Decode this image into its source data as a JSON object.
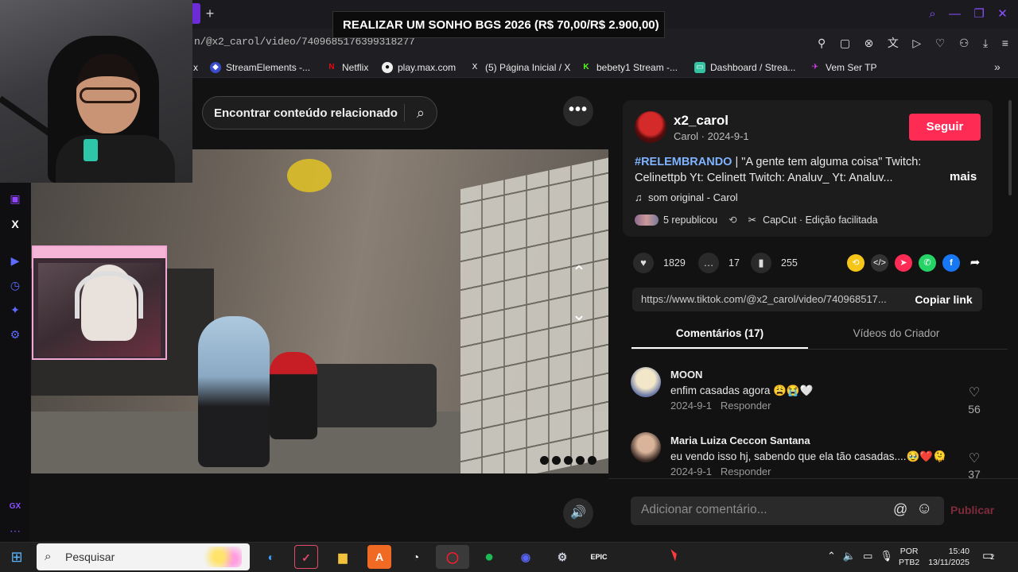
{
  "browser": {
    "banner": "REALIZAR UM SONHO BGS 2026 (R$ 70,00/R$ 2.900,00)",
    "url": "n/@x2_carol/video/7409685176399318277",
    "new_tab": "+"
  },
  "bookmarks": [
    {
      "label": "x",
      "icon": "close-icon"
    },
    {
      "label": "StreamElements -...",
      "icon": "streamelements-icon"
    },
    {
      "label": "Netflix",
      "icon": "netflix-icon"
    },
    {
      "label": "play.max.com",
      "icon": "max-icon"
    },
    {
      "label": "(5) Página Inicial / X",
      "icon": "x-icon"
    },
    {
      "label": "bebety1 Stream -...",
      "icon": "kick-icon"
    },
    {
      "label": "Dashboard / Strea...",
      "icon": "streamlabs-icon"
    },
    {
      "label": "Vem Ser TP",
      "icon": "tp-icon"
    }
  ],
  "search": {
    "label": "Encontrar conteúdo relacionado"
  },
  "video": {
    "more": "•••",
    "up": "⌃",
    "down": "⌄",
    "volume": "🔊"
  },
  "post": {
    "author": "x2_carol",
    "sub": "Carol · 2024-9-1",
    "follow": "Seguir",
    "hashtag": "#RELEMBRANDO",
    "description": " | \"A gente tem alguma coisa\" Twitch: Celinettpb  Yt: Celinett Twitch: Analuv_  Yt: Analuv...",
    "more": "mais",
    "sound": "som original - Carol",
    "reposts": "5 republicou",
    "capcut": "CapCut · Edição facilitada",
    "likes": "1829",
    "comments": "17",
    "saves": "255",
    "link": "https://www.tiktok.com/@x2_carol/video/740968517...",
    "copy": "Copiar link"
  },
  "tabs": {
    "comments": "Comentários (17)",
    "creator": "Vídeos do Criador"
  },
  "comments": [
    {
      "name": "MOON",
      "text": "enfim casadas agora 😩😭🤍",
      "date": "2024-9-1",
      "reply": "Responder",
      "likes": "56"
    },
    {
      "name": "Maria Luiza Ceccon Santana",
      "text": "eu vendo isso hj, sabendo que ela tão casadas....🥹❤️🫠",
      "date": "2024-9-1",
      "reply": "Responder",
      "likes": "37"
    }
  ],
  "compose": {
    "placeholder": "Adicionar comentário...",
    "publish": "Publicar",
    "at": "@",
    "emoji": "☺"
  },
  "taskbar": {
    "search": "Pesquisar",
    "lang1": "POR",
    "lang2": "PTB2",
    "time": "15:40",
    "date": "13/11/2025",
    "notif": "2"
  },
  "colors": {
    "accent": "#fe2c55",
    "hashtag": "#7fb3ff",
    "browser_accent": "#8a4fff"
  }
}
